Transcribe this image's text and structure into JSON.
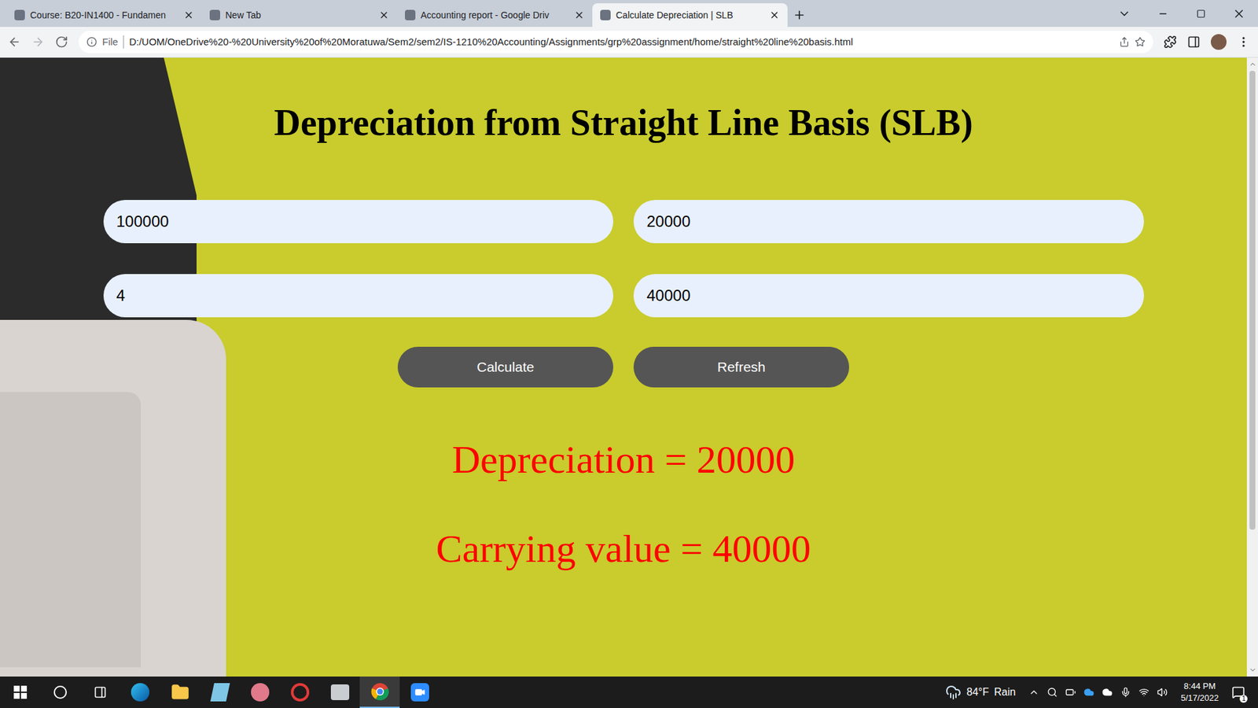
{
  "browser": {
    "tabs": [
      {
        "label": "Course: B20-IN1400 - Fundamen",
        "selected": false
      },
      {
        "label": "New Tab",
        "selected": false
      },
      {
        "label": "Accounting report - Google Driv",
        "selected": false
      },
      {
        "label": "Calculate Depreciation | SLB",
        "selected": true
      }
    ],
    "address": {
      "scheme": "File",
      "url": "D:/UOM/OneDrive%20-%20University%20of%20Moratuwa/Sem2/sem2/IS-1210%20Accounting/Assignments/grp%20assignment/home/straight%20line%20basis.html"
    }
  },
  "page": {
    "heading": "Depreciation from Straight Line Basis (SLB)",
    "fields": [
      {
        "value": "100000"
      },
      {
        "value": "20000"
      },
      {
        "value": "4"
      },
      {
        "value": "40000"
      }
    ],
    "buttons": [
      "Calculate",
      "Refresh"
    ],
    "results": [
      "Depreciation = 20000",
      "Carrying value = 40000"
    ]
  },
  "taskbar": {
    "weather": {
      "temp": "84°F",
      "condition": "Rain"
    },
    "time": "8:44 PM",
    "date": "5/17/2022",
    "notifications": "1"
  }
}
